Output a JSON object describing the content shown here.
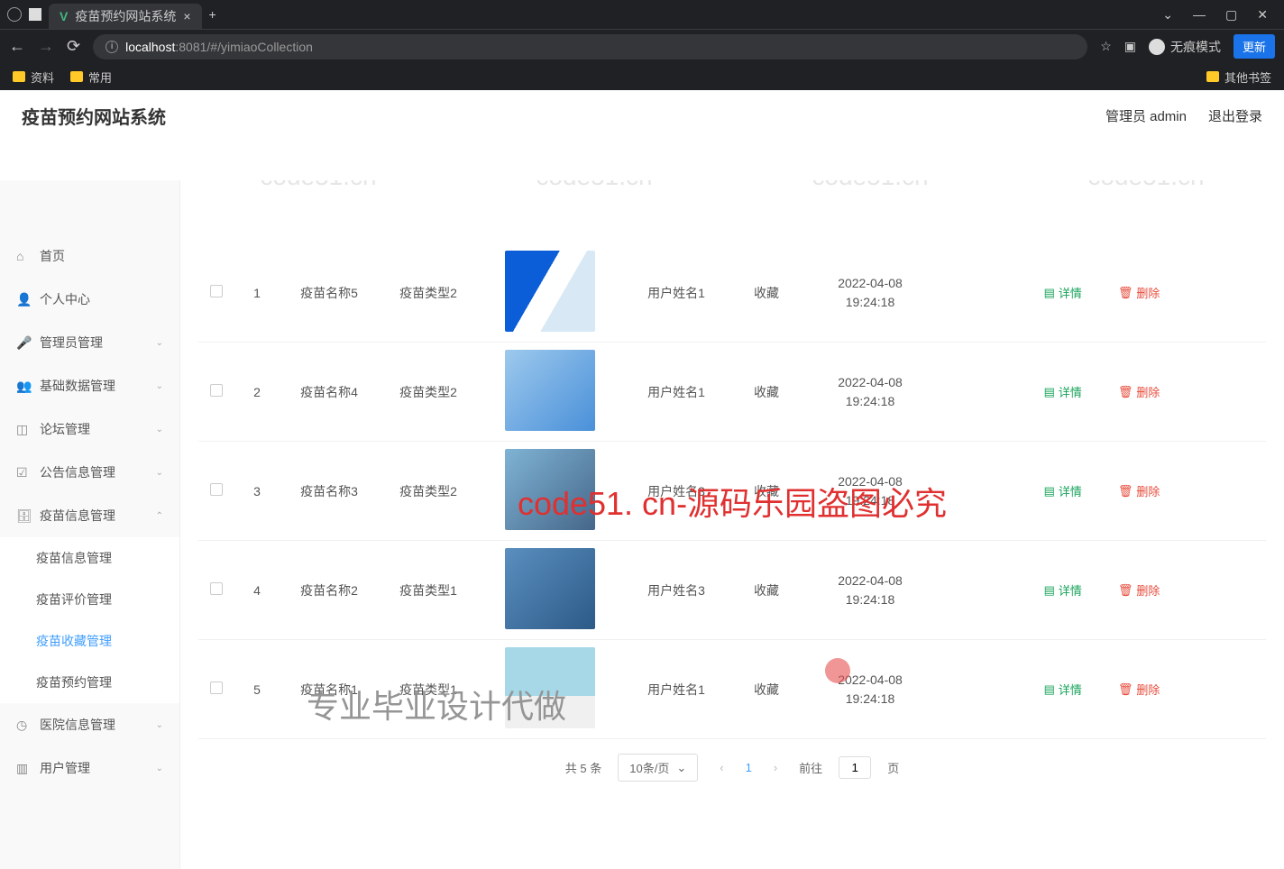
{
  "browser": {
    "tab_title": "疫苗预约网站系统",
    "url_host": "localhost",
    "url_port": ":8081",
    "url_path": "/#/yimiaoCollection",
    "incognito_label": "无痕模式",
    "update_label": "更新",
    "bookmark1": "资料",
    "bookmark2": "常用",
    "bookmark_other": "其他书签"
  },
  "header": {
    "title": "疫苗预约网站系统",
    "user_label": "管理员 admin",
    "logout_label": "退出登录"
  },
  "sidebar": {
    "items": [
      {
        "icon": "home",
        "label": "首页"
      },
      {
        "icon": "user",
        "label": "个人中心"
      },
      {
        "icon": "mic",
        "label": "管理员管理",
        "arrow": true
      },
      {
        "icon": "user2",
        "label": "基础数据管理",
        "arrow": true
      },
      {
        "icon": "crop",
        "label": "论坛管理",
        "arrow": true
      },
      {
        "icon": "check",
        "label": "公告信息管理",
        "arrow": true
      },
      {
        "icon": "db",
        "label": "疫苗信息管理",
        "arrow": true,
        "open": true,
        "children": [
          {
            "label": "疫苗信息管理"
          },
          {
            "label": "疫苗评价管理"
          },
          {
            "label": "疫苗收藏管理",
            "active": true
          },
          {
            "label": "疫苗预约管理"
          }
        ]
      },
      {
        "icon": "clock",
        "label": "医院信息管理",
        "arrow": true
      },
      {
        "icon": "cube",
        "label": "用户管理",
        "arrow": true
      }
    ]
  },
  "table": {
    "rows": [
      {
        "idx": "1",
        "name": "疫苗名称5",
        "type": "疫苗类型2",
        "user": "用户姓名1",
        "status": "收藏",
        "time1": "2022-04-08",
        "time2": "19:24:18"
      },
      {
        "idx": "2",
        "name": "疫苗名称4",
        "type": "疫苗类型2",
        "user": "用户姓名1",
        "status": "收藏",
        "time1": "2022-04-08",
        "time2": "19:24:18"
      },
      {
        "idx": "3",
        "name": "疫苗名称3",
        "type": "疫苗类型2",
        "user": "用户姓名3",
        "status": "收藏",
        "time1": "2022-04-08",
        "time2": "19:24:18"
      },
      {
        "idx": "4",
        "name": "疫苗名称2",
        "type": "疫苗类型1",
        "user": "用户姓名3",
        "status": "收藏",
        "time1": "2022-04-08",
        "time2": "19:24:18"
      },
      {
        "idx": "5",
        "name": "疫苗名称1",
        "type": "疫苗类型1",
        "user": "用户姓名1",
        "status": "收藏",
        "time1": "2022-04-08",
        "time2": "19:24:18"
      }
    ],
    "detail_label": "详情",
    "delete_label": "删除"
  },
  "pagination": {
    "total": "共 5 条",
    "per_page": "10条/页",
    "page": "1",
    "goto_prefix": "前往",
    "goto_value": "1",
    "goto_suffix": "页"
  },
  "watermark": {
    "text": "code51.cn",
    "big": "code51. cn-源码乐园盗图必究",
    "sub": "专业毕业设计代做"
  }
}
